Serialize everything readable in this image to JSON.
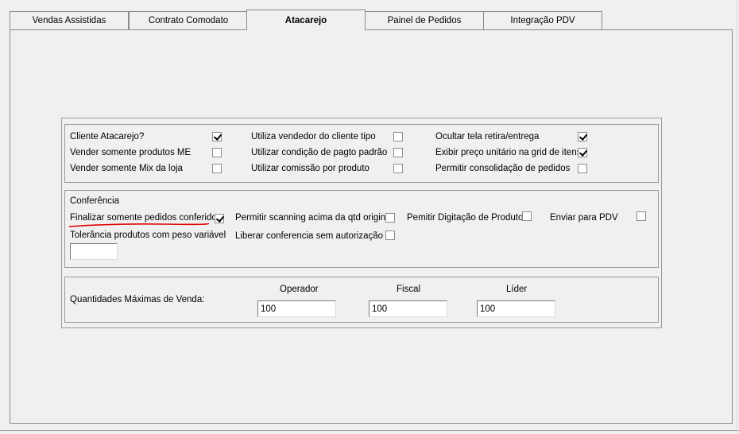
{
  "tabs": [
    {
      "label": "Vendas Assistidas"
    },
    {
      "label": "Contrato Comodato"
    },
    {
      "label": "Atacarejo"
    },
    {
      "label": "Painel de Pedidos"
    },
    {
      "label": "Integração PDV"
    }
  ],
  "general": {
    "cliente_atacarejo": {
      "label": "Cliente Atacarejo?",
      "checked": true
    },
    "vender_somente_produtos_me": {
      "label": "Vender somente produtos ME",
      "checked": false
    },
    "vender_somente_mix": {
      "label": "Vender somente Mix da loja",
      "checked": false
    },
    "utiliza_vendedor": {
      "label": "Utiliza vendedor do cliente tipo",
      "checked": false
    },
    "utilizar_condicao": {
      "label": "Utilizar condição de pagto padrão",
      "checked": false
    },
    "utilizar_comissao": {
      "label": "Utilizar comissão por produto",
      "checked": false
    },
    "ocultar_tela": {
      "label": "Ocultar tela retira/entrega",
      "checked": true
    },
    "exibir_preco": {
      "label": "Exibir preço unitário na grid de itens",
      "checked": true
    },
    "permitir_consolidacao": {
      "label": "Permitir consolidação de pedidos",
      "checked": false
    }
  },
  "conferencia": {
    "title": "Conferência",
    "finalizar_conferidos": {
      "label": "Finalizar somente pedidos conferidos",
      "checked": true
    },
    "permitir_scanning": {
      "label": "Permitir scanning acima da qtd original",
      "checked": false
    },
    "permitir_digitacao": {
      "label": "Pemitir Digitação de Produtos",
      "checked": false
    },
    "enviar_pdv": {
      "label": "Enviar para PDV",
      "checked": false
    },
    "tolerancia": {
      "label": "Tolerância produtos com peso variável",
      "value": ""
    },
    "liberar_conferencia": {
      "label": "Liberar conferencia sem autorização",
      "checked": false
    }
  },
  "quantidades": {
    "label": "Quantidades Máximas de Venda:",
    "operador": {
      "label": "Operador",
      "value": "100"
    },
    "fiscal": {
      "label": "Fiscal",
      "value": "100"
    },
    "lider": {
      "label": "Líder",
      "value": "100"
    }
  },
  "colors": {
    "annotation_underline": "#e00000"
  }
}
